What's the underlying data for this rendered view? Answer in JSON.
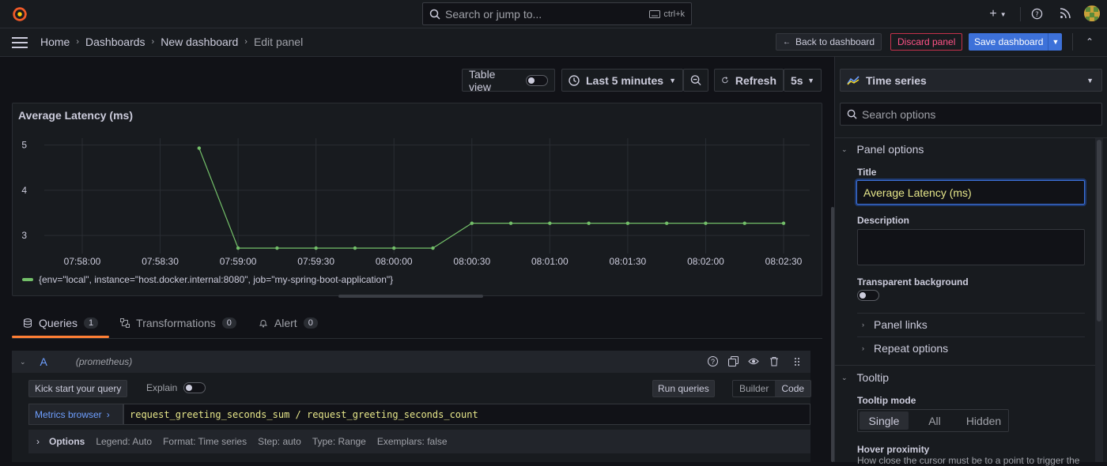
{
  "search": {
    "placeholder": "Search or jump to...",
    "shortcut": "ctrl+k"
  },
  "breadcrumbs": [
    "Home",
    "Dashboards",
    "New dashboard",
    "Edit panel"
  ],
  "actions": {
    "back": "Back to dashboard",
    "discard": "Discard panel",
    "save": "Save dashboard"
  },
  "toolbar": {
    "table_view": "Table view",
    "time_range": "Last 5 minutes",
    "refresh": "Refresh",
    "interval": "5s"
  },
  "panel": {
    "title": "Average Latency (ms)",
    "legend": "{env=\"local\", instance=\"host.docker.internal:8080\", job=\"my-spring-boot-application\"}"
  },
  "chart_data": {
    "type": "line",
    "title": "Average Latency (ms)",
    "x_ticks": [
      "07:58:00",
      "07:58:30",
      "07:59:00",
      "07:59:30",
      "08:00:00",
      "08:00:30",
      "08:01:00",
      "08:01:30",
      "08:02:00",
      "08:02:30"
    ],
    "y_ticks": [
      "5",
      "4",
      "3"
    ],
    "ylim": [
      2.6,
      5.15
    ],
    "series": [
      {
        "name": "{env=\"local\", instance=\"host.docker.internal:8080\", job=\"my-spring-boot-application\"}",
        "color": "#73bf69",
        "x": [
          "07:58:45",
          "07:59:00",
          "07:59:15",
          "07:59:30",
          "07:59:45",
          "08:00:00",
          "08:00:15",
          "08:00:30",
          "08:00:45",
          "08:01:00",
          "08:01:15",
          "08:01:30",
          "08:01:45",
          "08:02:00",
          "08:02:15",
          "08:02:30"
        ],
        "values": [
          4.93,
          2.72,
          2.72,
          2.72,
          2.72,
          2.72,
          2.72,
          3.27,
          3.27,
          3.27,
          3.27,
          3.27,
          3.27,
          3.27,
          3.27,
          3.27
        ]
      }
    ],
    "grid": true,
    "legend_position": "bottom-left"
  },
  "tabs": [
    {
      "label": "Queries",
      "count": "1"
    },
    {
      "label": "Transformations",
      "count": "0"
    },
    {
      "label": "Alert",
      "count": "0"
    }
  ],
  "query": {
    "ref": "A",
    "datasource": "(prometheus)",
    "kick_start": "Kick start your query",
    "explain": "Explain",
    "run": "Run queries",
    "mode_builder": "Builder",
    "mode_code": "Code",
    "metrics_browser": "Metrics browser",
    "expression": "request_greeting_seconds_sum / request_greeting_seconds_count",
    "options_label": "Options",
    "options": [
      "Legend: Auto",
      "Format: Time series",
      "Step: auto",
      "Type: Range",
      "Exemplars: false"
    ]
  },
  "sidebar": {
    "viz": "Time series",
    "search_placeholder": "Search options",
    "panel_options": "Panel options",
    "title_label": "Title",
    "title_value": "Average Latency (ms)",
    "description_label": "Description",
    "transparent_label": "Transparent background",
    "panel_links": "Panel links",
    "repeat_options": "Repeat options",
    "tooltip": "Tooltip",
    "tooltip_mode_label": "Tooltip mode",
    "tooltip_modes": [
      "Single",
      "All",
      "Hidden"
    ],
    "hover_label": "Hover proximity",
    "hover_desc": "How close the cursor must be to a point to trigger the"
  }
}
